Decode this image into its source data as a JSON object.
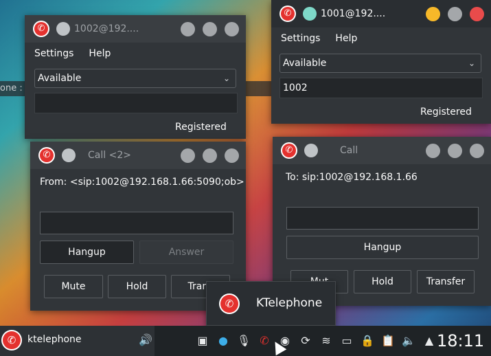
{
  "background_strip_text": "one : b",
  "win_1002": {
    "title": "1002@192....",
    "menu": [
      "Settings",
      "Help"
    ],
    "status_select": "Available",
    "number_field": "",
    "registration": "Registered"
  },
  "win_1001": {
    "title": "1001@192....",
    "menu": [
      "Settings",
      "Help"
    ],
    "status_select": "Available",
    "number_field": "1002",
    "registration": "Registered"
  },
  "call_incoming": {
    "title": "Call <2>",
    "from_text": "From: <sip:1002@192.168.1.66:5090;ob>",
    "dtmf_field": "",
    "hangup": "Hangup",
    "answer": "Answer",
    "mute": "Mute",
    "hold": "Hold",
    "transfer": "Trans"
  },
  "call_outgoing": {
    "title": "Call",
    "to_text": "To: sip:1002@192.168.1.66",
    "dtmf_field": "",
    "hangup": "Hangup",
    "mute": "Mut",
    "hold": "Hold",
    "transfer": "Transfer"
  },
  "popup": {
    "label": "KTelephone"
  },
  "taskbar": {
    "task_label": "ktelephone",
    "clock": "18:11",
    "tray_icons": [
      "chip-icon",
      "info-icon",
      "microphone-icon",
      "phone-icon",
      "discord-icon",
      "update-icon",
      "wifi-icon",
      "battery-icon",
      "lock-icon",
      "clipboard-icon",
      "volume-icon",
      "chevron-up-icon"
    ]
  },
  "colors": {
    "accent_red": "#e4312e",
    "close": "#e94b4b",
    "minimize": "#f7b829"
  }
}
